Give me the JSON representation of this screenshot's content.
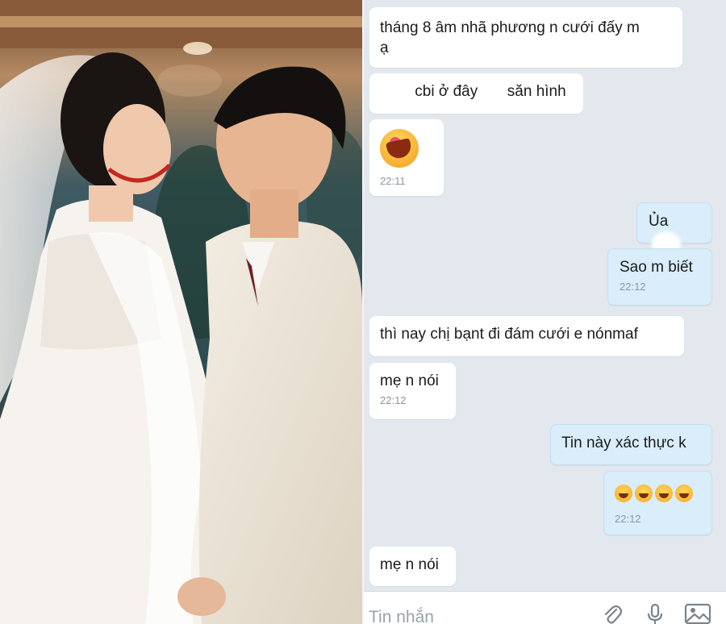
{
  "chat": {
    "messages": [
      {
        "side": "in",
        "text_line1": "tháng 8 âm nhã phương n cưới đấy m",
        "text_line2": "ạ"
      },
      {
        "side": "in",
        "text_a": "cbi ở đây",
        "text_b": "săn hình"
      },
      {
        "side": "in",
        "emoji": "laughing-emoji",
        "time": "22:11"
      },
      {
        "side": "out",
        "text": "Ủa"
      },
      {
        "side": "out",
        "text": "Sao m biết",
        "time": "22:12"
      },
      {
        "side": "in",
        "text": "thì nay chị bạnt  đi đám cưới e nónmaf"
      },
      {
        "side": "in",
        "text": "mẹ n nói",
        "time": "22:12"
      },
      {
        "side": "out",
        "text": "Tin này xác thực k"
      },
      {
        "side": "out",
        "emoji": "tears-of-joy-emoji x4",
        "time": "22:12"
      },
      {
        "side": "in",
        "text": "mẹ n nói"
      }
    ],
    "composer": {
      "placeholder": "Tin nhắn",
      "icons": [
        "paperclip-icon",
        "microphone-icon",
        "image-icon"
      ]
    }
  },
  "colors": {
    "chat_background": "#e3e8ee",
    "incoming_bubble": "#ffffff",
    "outgoing_bubble": "#d9edfa",
    "time_text": "#8c96a0"
  }
}
